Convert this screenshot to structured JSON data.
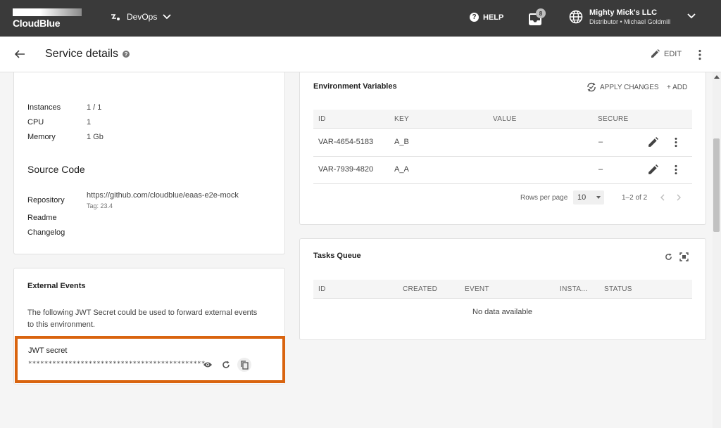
{
  "topbar": {
    "logo_text": "CloudBlue",
    "app_name": "DevOps",
    "help_label": "HELP",
    "inbox_count": "8",
    "account_name": "Mighty Mick's LLC",
    "account_sub": "Distributor • Michael Goldmill"
  },
  "header": {
    "title": "Service details",
    "edit_label": "EDIT"
  },
  "resources": {
    "items": [
      {
        "label": "Instances",
        "value": "1 / 1"
      },
      {
        "label": "CPU",
        "value": "1"
      },
      {
        "label": "Memory",
        "value": "1 Gb"
      }
    ]
  },
  "source_code": {
    "title": "Source Code",
    "repository_label": "Repository",
    "repository_url": "https://github.com/cloudblue/eaas-e2e-mock",
    "tag": "Tag: 23.4",
    "readme_label": "Readme",
    "changelog_label": "Changelog"
  },
  "external_events": {
    "title": "External Events",
    "description_line1": "The following JWT Secret could be used to forward external events",
    "description_line2": "to this environment.",
    "jwt_label": "JWT secret",
    "jwt_value": "********************************************"
  },
  "env_vars": {
    "title": "Environment Variables",
    "apply_label": "APPLY CHANGES",
    "add_label": "+ ADD",
    "columns": [
      "ID",
      "KEY",
      "VALUE",
      "SECURE"
    ],
    "rows": [
      {
        "id": "VAR-4654-5183",
        "key": "A_B",
        "value": "",
        "secure": "–"
      },
      {
        "id": "VAR-7939-4820",
        "key": "A_A",
        "value": "",
        "secure": "–"
      }
    ],
    "rows_per_page_label": "Rows per page",
    "rows_per_page": "10",
    "range": "1–2 of 2"
  },
  "tasks_queue": {
    "title": "Tasks Queue",
    "columns": [
      "ID",
      "CREATED",
      "EVENT",
      "INSTA...",
      "STATUS"
    ],
    "empty": "No data available"
  },
  "colors": {
    "topbar": "#3a3a3a",
    "highlight": "#d9640f"
  }
}
